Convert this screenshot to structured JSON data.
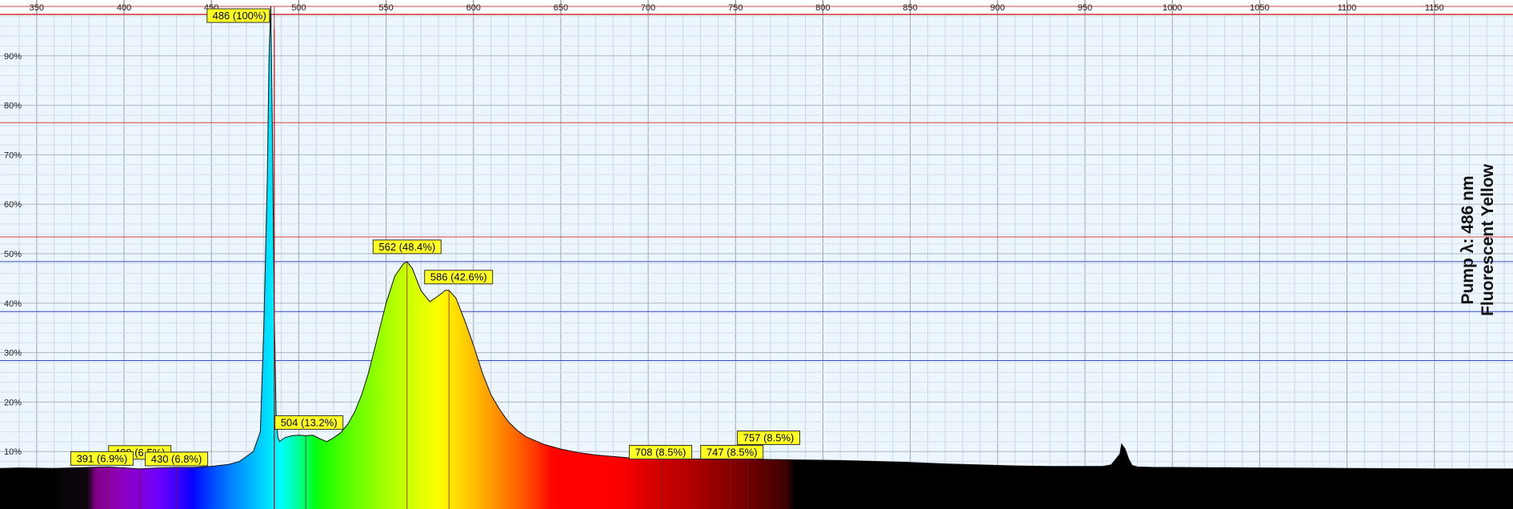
{
  "chart_data": {
    "type": "area",
    "title": "",
    "xlabel": "",
    "ylabel": "",
    "xlim": [
      329,
      1195
    ],
    "ylim": [
      0,
      100
    ],
    "x_ticks": [
      350,
      400,
      450,
      500,
      550,
      600,
      650,
      700,
      750,
      800,
      850,
      900,
      950,
      1000,
      1050,
      1100,
      1150
    ],
    "y_ticks": [
      10,
      20,
      30,
      40,
      50,
      60,
      70,
      80,
      90
    ],
    "y_tick_suffix": "%",
    "grid": true,
    "fill": "visible-spectrum-gradient",
    "side_labels": [
      "Pump λ: 486 nm",
      "Fluorescent Yellow"
    ],
    "peak_labels": [
      {
        "x": 486,
        "y": 100,
        "text": "486 (100%)"
      },
      {
        "x": 562,
        "y": 48.4,
        "text": "562 (48.4%)"
      },
      {
        "x": 586,
        "y": 42.6,
        "text": "586 (42.6%)"
      },
      {
        "x": 504,
        "y": 13.2,
        "text": "504 (13.2%)"
      },
      {
        "x": 409,
        "y": 6.5,
        "text": "409 (6.5%)"
      },
      {
        "x": 391,
        "y": 6.9,
        "text": "391 (6.9%)"
      },
      {
        "x": 430,
        "y": 6.8,
        "text": "430 (6.8%)"
      },
      {
        "x": 708,
        "y": 8.5,
        "text": "708 (8.5%)"
      },
      {
        "x": 747,
        "y": 8.5,
        "text": "747 (8.5%)"
      },
      {
        "x": 757,
        "y": 8.5,
        "text": "757 (8.5%)"
      }
    ],
    "series": [
      {
        "x": [
          329,
          340,
          360,
          380,
          391,
          400,
          409,
          420,
          430,
          440,
          450,
          460,
          466,
          470,
          474,
          476,
          478,
          480,
          482,
          483,
          484,
          485,
          486,
          487,
          488,
          489,
          490,
          492,
          496,
          500,
          504,
          508,
          512,
          516,
          520,
          524,
          528,
          532,
          536,
          540,
          545,
          550,
          555,
          560,
          562,
          565,
          570,
          575,
          580,
          584,
          586,
          590,
          595,
          600,
          605,
          610,
          615,
          620,
          625,
          630,
          640,
          650,
          660,
          670,
          680,
          690,
          700,
          708,
          720,
          730,
          740,
          747,
          757,
          770,
          790,
          810,
          830,
          850,
          870,
          890,
          910,
          930,
          950,
          960,
          965,
          970,
          971,
          973,
          975,
          977,
          980,
          990,
          1000,
          1050,
          1100,
          1150,
          1195
        ],
        "y": [
          6.6,
          6.7,
          6.6,
          6.8,
          6.9,
          6.7,
          6.5,
          6.7,
          6.8,
          6.8,
          7.0,
          7.4,
          8.0,
          9.0,
          10.0,
          12.0,
          14.0,
          35.0,
          65.0,
          90.0,
          100.0,
          72.0,
          38.0,
          18.0,
          13.0,
          12.0,
          12.3,
          12.8,
          13.2,
          13.3,
          13.2,
          13.3,
          12.6,
          12.0,
          12.8,
          13.8,
          15.5,
          18.0,
          21.5,
          26.0,
          33.0,
          40.0,
          45.5,
          48.0,
          48.4,
          47.0,
          42.5,
          40.3,
          41.5,
          42.6,
          42.6,
          41.0,
          36.5,
          31.5,
          26.0,
          21.5,
          18.5,
          16.0,
          14.3,
          13.0,
          11.5,
          10.5,
          9.8,
          9.3,
          9.0,
          8.7,
          8.6,
          8.5,
          8.5,
          8.5,
          8.4,
          8.5,
          8.5,
          8.4,
          8.3,
          8.2,
          8.0,
          7.8,
          7.5,
          7.3,
          7.1,
          7.0,
          7.0,
          7.0,
          7.3,
          9.5,
          11.5,
          10.5,
          8.5,
          7.2,
          6.9,
          6.8,
          6.8,
          6.7,
          6.6,
          6.5,
          6.5
        ]
      }
    ]
  }
}
